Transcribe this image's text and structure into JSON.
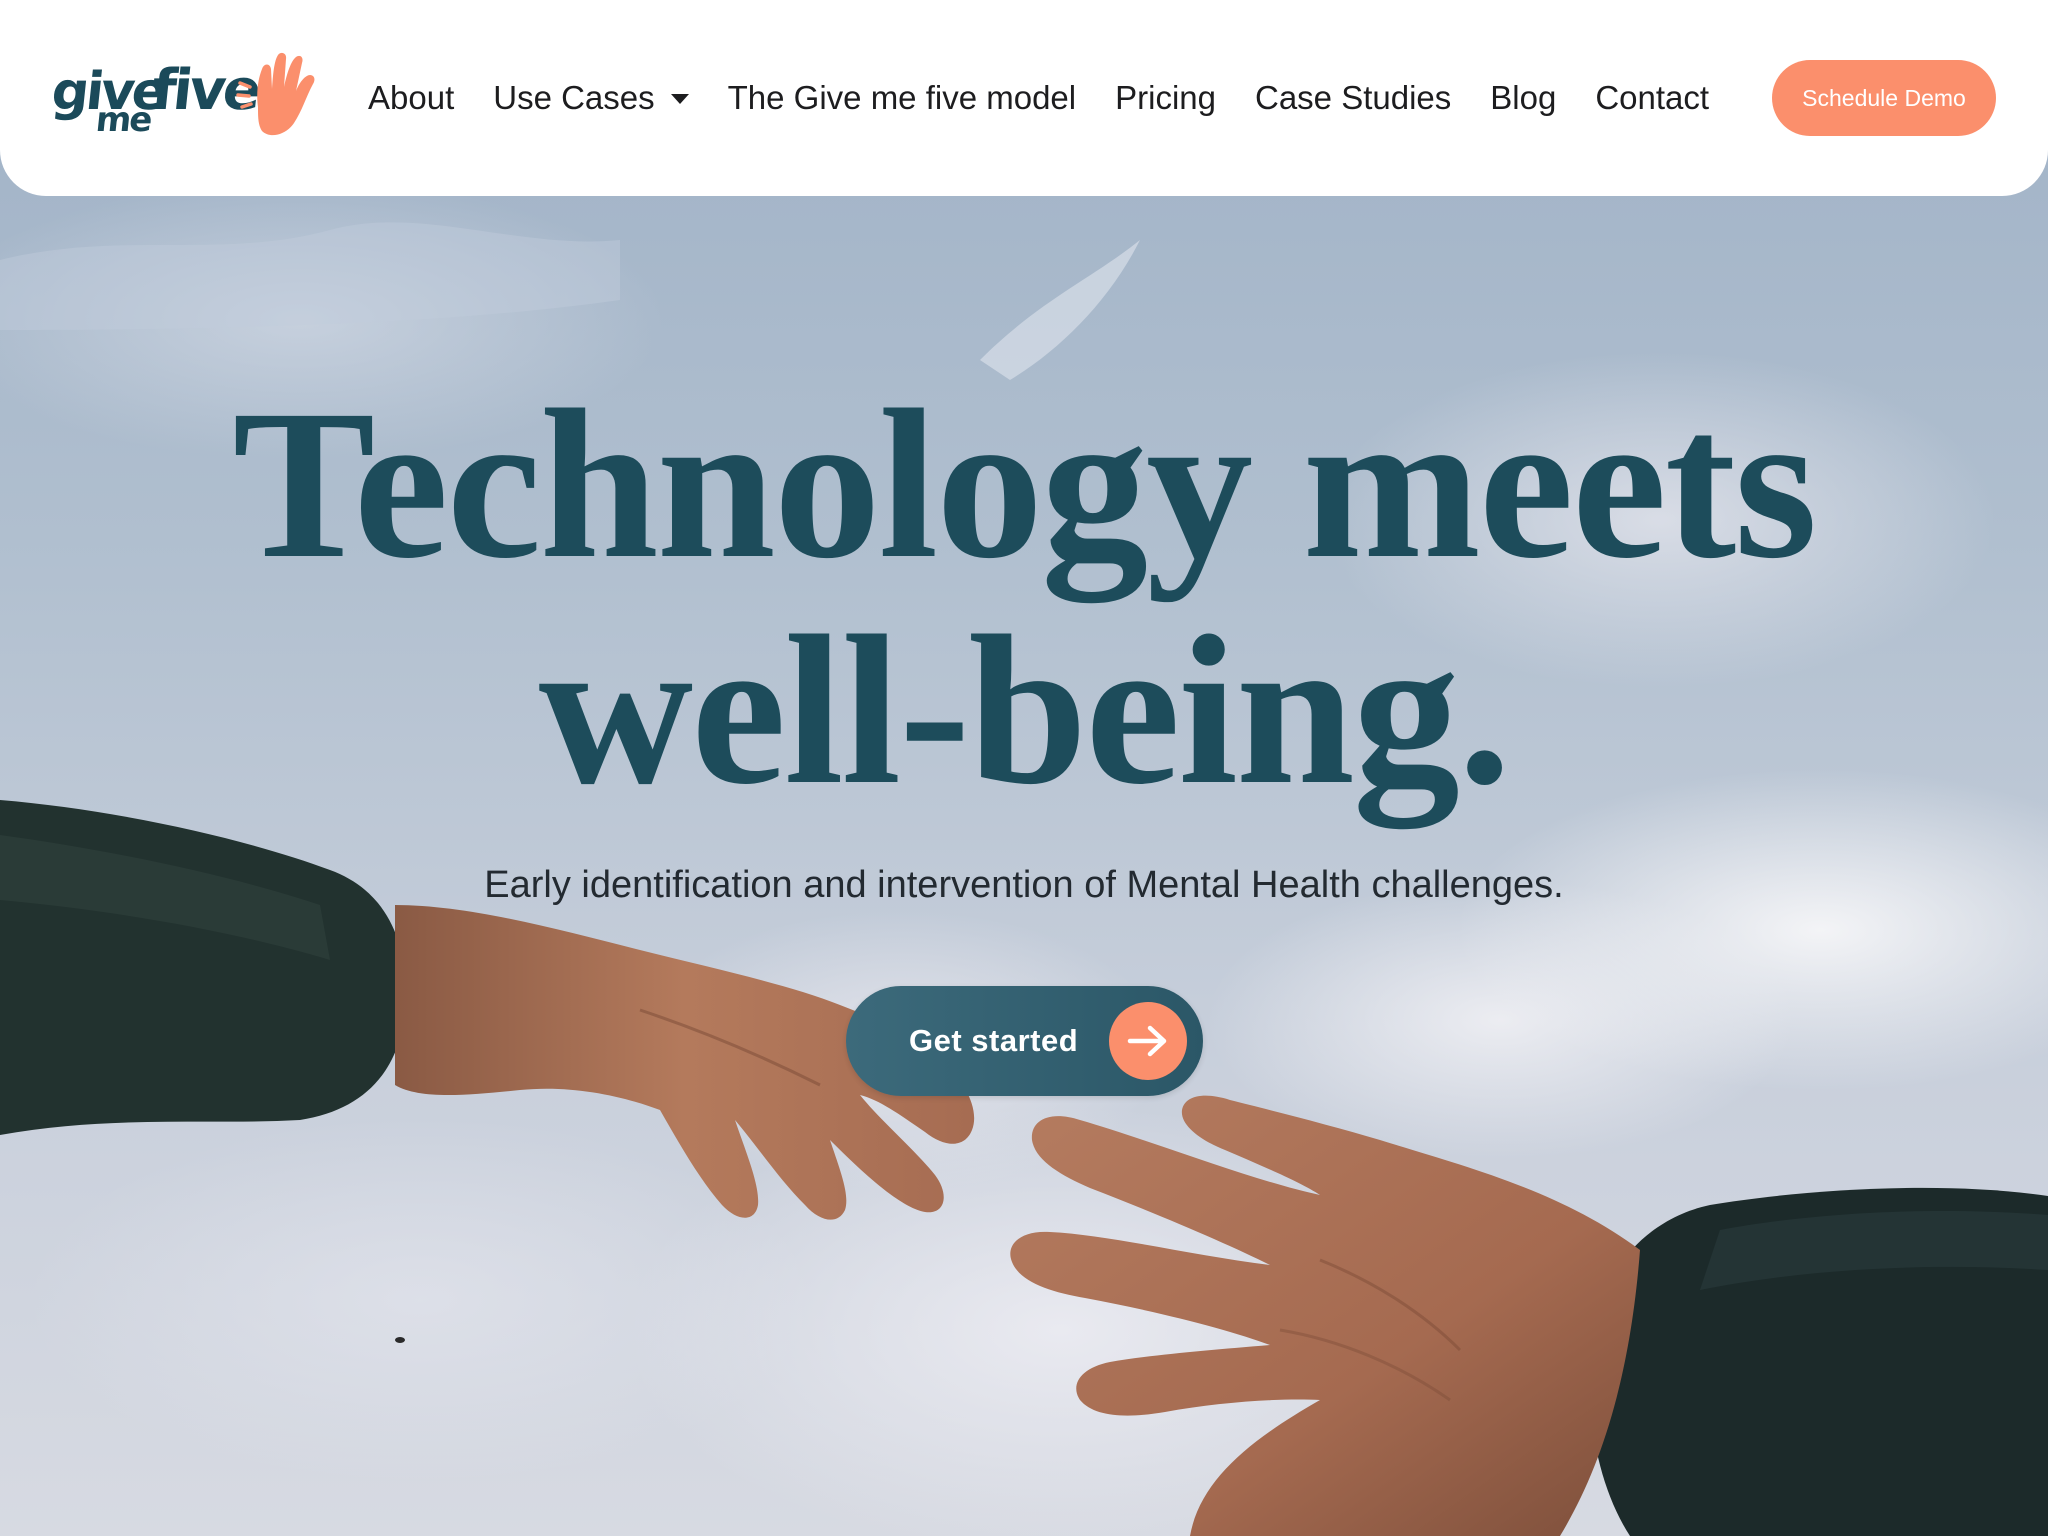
{
  "brand": {
    "logo_give": "give",
    "logo_me": "me",
    "logo_five": "five",
    "accent_color": "#fb8f6c",
    "primary_color": "#1d4c5b"
  },
  "nav": {
    "items": [
      {
        "label": "About"
      },
      {
        "label": "Use Cases",
        "has_dropdown": true
      },
      {
        "label": "The Give me five model"
      },
      {
        "label": "Pricing"
      },
      {
        "label": "Case Studies"
      },
      {
        "label": "Blog"
      },
      {
        "label": "Contact"
      }
    ],
    "cta_label": "Schedule Demo"
  },
  "hero": {
    "headline_line1": "Technology meets",
    "headline_line2": "well-being.",
    "subheadline": "Early identification and intervention of Mental Health challenges.",
    "cta_label": "Get started",
    "cta_icon": "arrow-right-icon",
    "background": "photo of two hands reaching toward each other against a cloudy sky"
  }
}
